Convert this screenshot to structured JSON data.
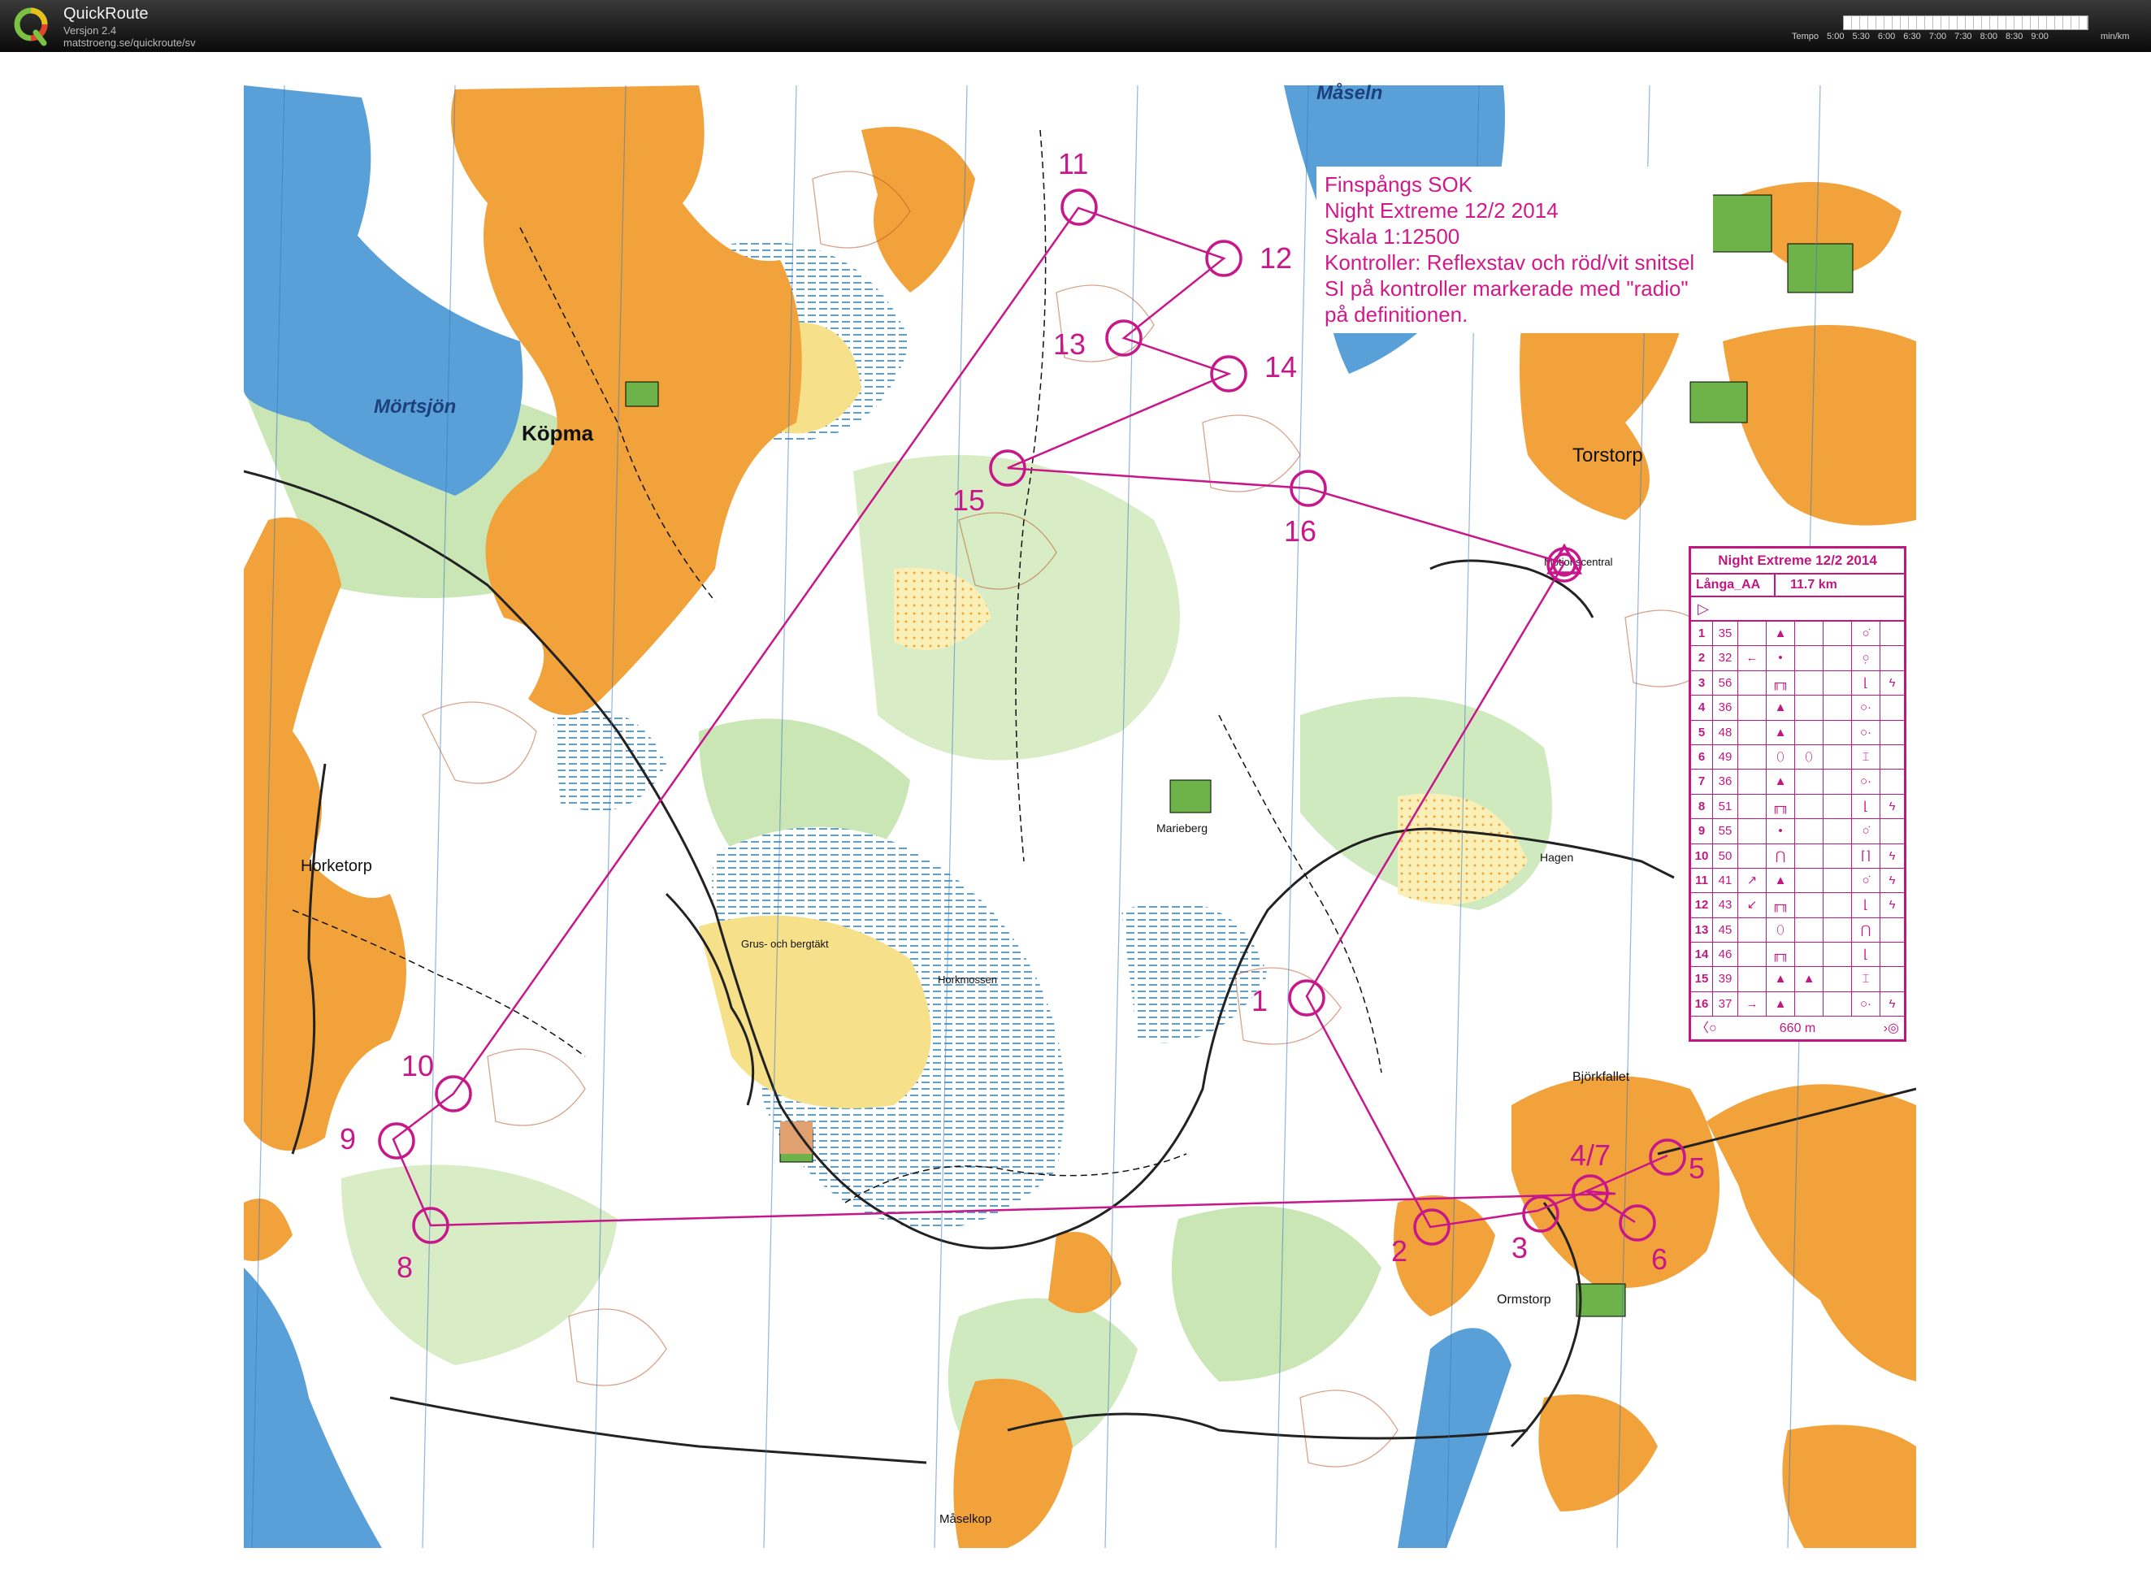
{
  "app": {
    "title": "QuickRoute",
    "version": "Versjon 2.4",
    "url": "matstroeng.se/quickroute/sv",
    "pace_label": "Tempo",
    "pace_ticks": [
      "5:00",
      "5:30",
      "6:00",
      "6:30",
      "7:00",
      "7:30",
      "8:00",
      "8:30",
      "9:00"
    ],
    "pace_unit": "min/km"
  },
  "map": {
    "place_names": [
      "Måseln",
      "Mörtsjön",
      "Köpma",
      "Torstorp",
      "Motionscentral",
      "Horketorp",
      "Grus- och bergtäkt",
      "Horkmossen",
      "Marieberg",
      "Hagen",
      "Björkfallet",
      "Ormstorp",
      "Måselkop"
    ],
    "header_lines": [
      "Finspångs SOK",
      "Night Extreme 12/2 2014",
      "Skala 1:12500",
      "Kontroller: Reflexstav och röd/vit snitsel",
      "SI på kontroller markerade med \"radio\"",
      "på definitionen."
    ],
    "control_labels": [
      "1",
      "2",
      "3",
      "4/7",
      "5",
      "6",
      "8",
      "9",
      "10",
      "11",
      "12",
      "13",
      "14",
      "15",
      "16"
    ],
    "colors": {
      "course": "#c8178a",
      "open_land": "#f2a23a",
      "forest": "#ffffff",
      "green": "#b8dca0",
      "water": "#5aa0d8",
      "marsh": "#9cc8e8",
      "yellow": "#f6e08a"
    }
  },
  "control_description": {
    "title": "Night Extreme 12/2 2014",
    "class": "Långa_AA",
    "length": "11.7 km",
    "start_symbol": "▷",
    "rows": [
      {
        "n": "1",
        "code": "35",
        "d": "",
        "c": "▲",
        "e": "",
        "f": "",
        "g": "○̇",
        "h": ""
      },
      {
        "n": "2",
        "code": "32",
        "d": "←",
        "c": "•",
        "e": "",
        "f": "",
        "g": "○̣",
        "h": ""
      },
      {
        "n": "3",
        "code": "56",
        "d": "",
        "c": "╓╖",
        "e": "",
        "f": "",
        "g": "⌊",
        "h": "ϟ"
      },
      {
        "n": "4",
        "code": "36",
        "d": "",
        "c": "▲",
        "e": "",
        "f": "",
        "g": "○·",
        "h": ""
      },
      {
        "n": "5",
        "code": "48",
        "d": "",
        "c": "▲",
        "e": "",
        "f": "",
        "g": "○·",
        "h": ""
      },
      {
        "n": "6",
        "code": "49",
        "d": "",
        "c": "⬯",
        "e": "⬯",
        "f": "",
        "g": "⌶",
        "h": ""
      },
      {
        "n": "7",
        "code": "36",
        "d": "",
        "c": "▲",
        "e": "",
        "f": "",
        "g": "○·",
        "h": ""
      },
      {
        "n": "8",
        "code": "51",
        "d": "",
        "c": "╓╖",
        "e": "",
        "f": "",
        "g": "⌊",
        "h": "ϟ"
      },
      {
        "n": "9",
        "code": "55",
        "d": "",
        "c": "•",
        "e": "",
        "f": "",
        "g": "○̇",
        "h": ""
      },
      {
        "n": "10",
        "code": "50",
        "d": "",
        "c": "⋂",
        "e": "",
        "f": "",
        "g": "⌈⌉",
        "h": "ϟ"
      },
      {
        "n": "11",
        "code": "41",
        "d": "↗",
        "c": "▲",
        "e": "",
        "f": "",
        "g": "○̇",
        "h": "ϟ"
      },
      {
        "n": "12",
        "code": "43",
        "d": "↙",
        "c": "╓╖",
        "e": "",
        "f": "",
        "g": "⌊",
        "h": "ϟ"
      },
      {
        "n": "13",
        "code": "45",
        "d": "",
        "c": "⬯",
        "e": "",
        "f": "",
        "g": "⋂",
        "h": ""
      },
      {
        "n": "14",
        "code": "46",
        "d": "",
        "c": "╓╖",
        "e": "",
        "f": "",
        "g": "⌊",
        "h": ""
      },
      {
        "n": "15",
        "code": "39",
        "d": "",
        "c": "▲",
        "e": "▲",
        "f": "",
        "g": "⌶",
        "h": ""
      },
      {
        "n": "16",
        "code": "37",
        "d": "→",
        "c": "▲",
        "e": "",
        "f": "",
        "g": "○·",
        "h": "ϟ"
      }
    ],
    "finish_distance": "660 m"
  }
}
